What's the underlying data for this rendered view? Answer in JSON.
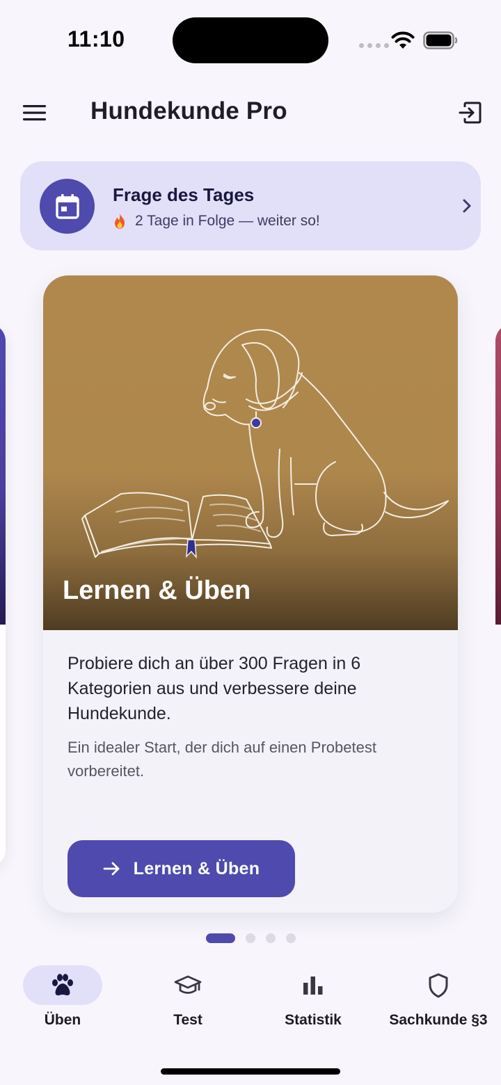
{
  "status": {
    "time": "11:10"
  },
  "app": {
    "title": "Hundekunde Pro"
  },
  "daily": {
    "title": "Frage des Tages",
    "subtitle": "2 Tage in Folge — weiter so!"
  },
  "card": {
    "title": "Lernen & Üben",
    "description": "Probiere dich an über 300 Fragen in 6 Kategorien aus und verbessere deine Hundekunde.",
    "hint": "Ein idealer Start, der dich auf einen Probetest vorbereitet.",
    "button_label": "Lernen & Üben"
  },
  "pager": {
    "count": 4,
    "active_index": 0
  },
  "nav": [
    {
      "label": "Üben",
      "icon": "paw-icon",
      "active": true
    },
    {
      "label": "Test",
      "icon": "graduation-cap-icon",
      "active": false
    },
    {
      "label": "Statistik",
      "icon": "bar-chart-icon",
      "active": false
    },
    {
      "label": "Sachkunde §3",
      "icon": "shield-icon",
      "active": false
    }
  ],
  "colors": {
    "accent": "#4F4AAD",
    "accent_light": "#E2DFF9",
    "hero_gold": "#B0884E",
    "background": "#F8F6FC"
  }
}
